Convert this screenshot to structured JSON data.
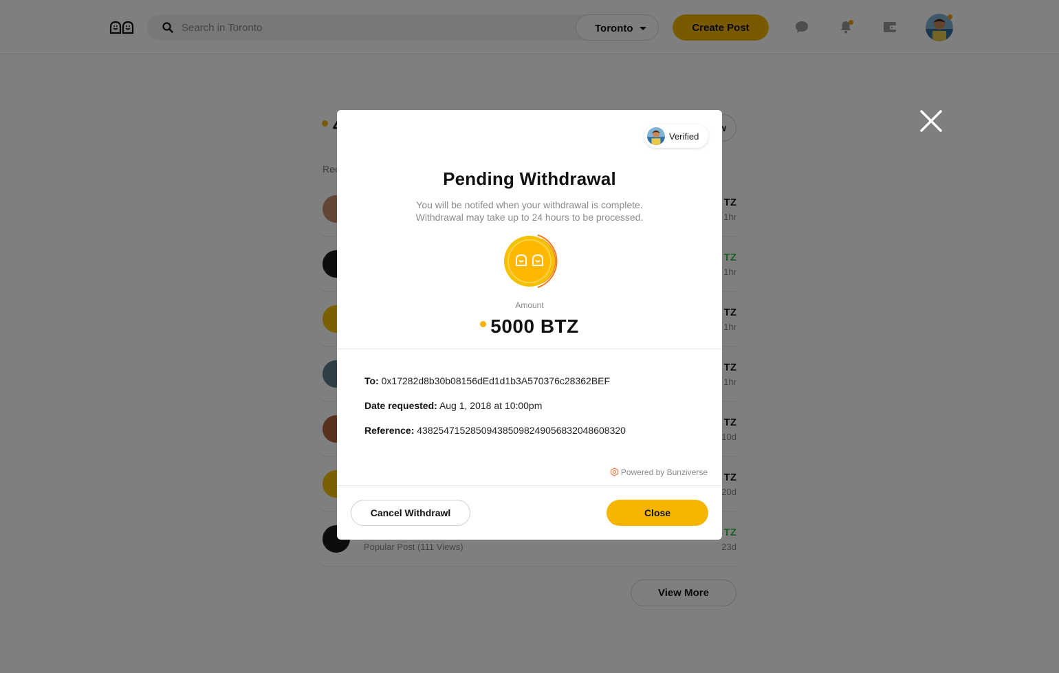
{
  "header": {
    "search_placeholder": "Search in Toronto",
    "city": "Toronto",
    "create_post": "Create Post",
    "icons": [
      "logo-icon",
      "search-icon",
      "chat-icon",
      "bell-icon",
      "wallet-icon",
      "avatar"
    ]
  },
  "background": {
    "section_label": "Rec",
    "view_more": "View More",
    "pill_glyph": "w",
    "title_glyph": "4",
    "rows": [
      {
        "amount": "TZ",
        "time": "1hr",
        "amount_color": "#111111",
        "sub": ""
      },
      {
        "amount": "TZ",
        "time": "1hr",
        "amount_color": "#3bb54a",
        "sub": ""
      },
      {
        "amount": "TZ",
        "time": "1hr",
        "amount_color": "#111111",
        "sub": ""
      },
      {
        "amount": "TZ",
        "time": "1hr",
        "amount_color": "#111111",
        "sub": ""
      },
      {
        "amount": "TZ",
        "time": "10d",
        "amount_color": "#111111",
        "sub": ""
      },
      {
        "amount": "TZ",
        "time": "20d",
        "amount_color": "#111111",
        "sub": ""
      },
      {
        "amount": "TZ",
        "time": "23d",
        "amount_color": "#3bb54a",
        "sub": "Popular Post (111 Views)"
      }
    ]
  },
  "modal": {
    "verified": "Verified",
    "title": "Pending Withdrawal",
    "subtitle_line1": "You will be notifed when your withdrawal is complete.",
    "subtitle_line2": "Withdrawal may take up to 24 hours to be processed.",
    "amount_label": "Amount",
    "amount": "5000 BTZ",
    "to_label": "To:",
    "to_value": "0x17282d8b30b08156dEd1d1b3A570376c28362BEF",
    "date_label": "Date requested:",
    "date_value": "Aug 1, 2018 at 10:00pm",
    "reference_label": "Reference:",
    "reference_value": "438254715285094385098249056832048608320",
    "powered_by": "Powered by Bunziverse",
    "cancel_button": "Cancel Withdrawl",
    "close_button": "Close"
  },
  "colors": {
    "accent": "#f5b400",
    "positive": "#3bb54a",
    "overlay": "rgba(0,0,0,0.5)"
  }
}
